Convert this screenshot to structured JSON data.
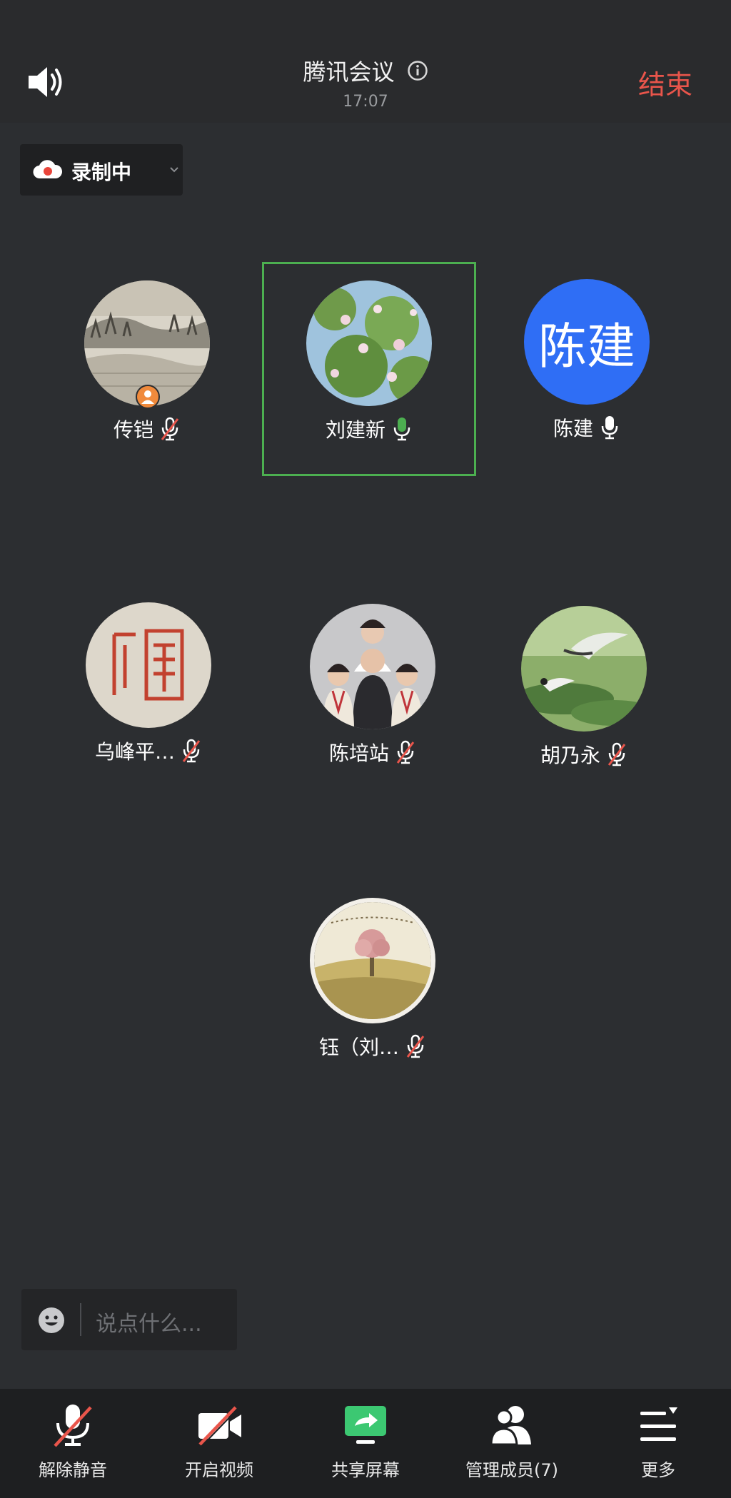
{
  "header": {
    "title": "腾讯会议",
    "time": "17:07",
    "end_label": "结束"
  },
  "recording": {
    "label": "录制中"
  },
  "participants": [
    {
      "name": "传铠",
      "mic": "muted",
      "host": true
    },
    {
      "name": "刘建新",
      "mic": "speaking",
      "active": true
    },
    {
      "name": "陈建",
      "mic": "on",
      "avatar_text": "陈建",
      "avatar_color": "#2f6ef5"
    },
    {
      "name": "乌峰平…",
      "mic": "muted"
    },
    {
      "name": "陈培站",
      "mic": "muted"
    },
    {
      "name": "胡乃永",
      "mic": "muted"
    },
    {
      "name": "钰（刘…",
      "mic": "muted"
    }
  ],
  "chat": {
    "placeholder": "说点什么..."
  },
  "toolbar": {
    "unmute": "解除静音",
    "video": "开启视频",
    "share": "共享屏幕",
    "members": "管理成员(7)",
    "more": "更多"
  },
  "colors": {
    "end": "#e9554b",
    "active_border": "#4caf50",
    "speaking_mic": "#4caf50",
    "share_icon": "#3cc872"
  }
}
